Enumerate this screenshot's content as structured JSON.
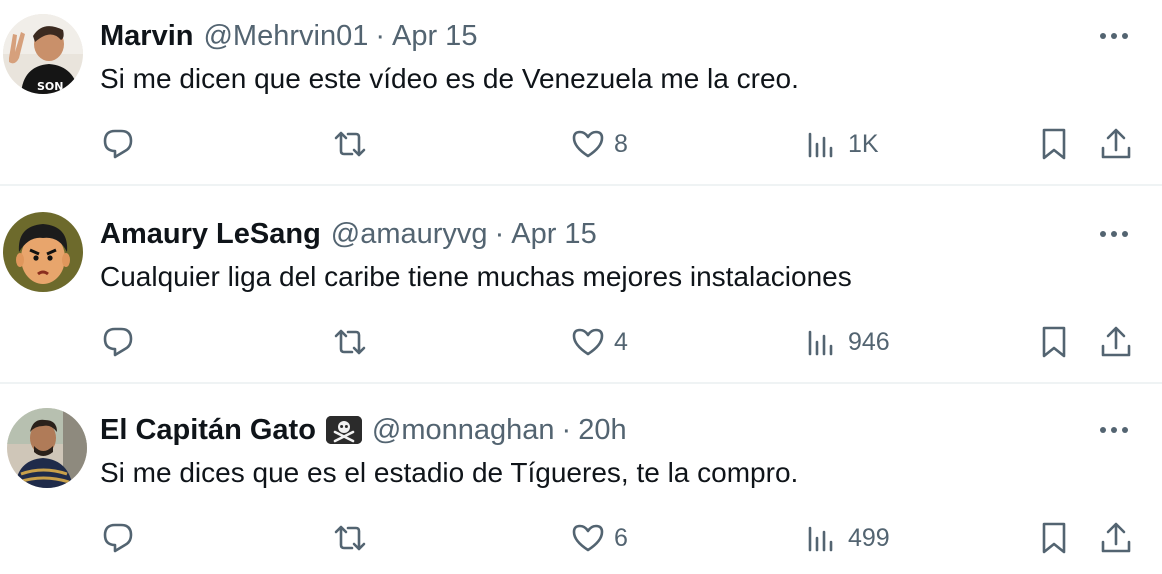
{
  "tweets": [
    {
      "display_name": "Marvin",
      "handle": "@Mehrvin01",
      "separator": "·",
      "time": "Apr 15",
      "text": "Si me dicen que este vídeo es de Venezuela me la creo.",
      "likes": "8",
      "views": "1K",
      "avatar_icon": "avatar-photo-peace-sign"
    },
    {
      "display_name": "Amaury LeSang",
      "handle": "@amauryvg",
      "separator": "·",
      "time": "Apr 15",
      "text": "Cualquier liga del caribe tiene muchas mejores instalaciones",
      "likes": "4",
      "views": "946",
      "avatar_icon": "avatar-cartoon-face"
    },
    {
      "display_name": "El Capitán Gato",
      "name_emoji": "pirate-flag-icon",
      "handle": "@monnaghan",
      "separator": "·",
      "time": "20h",
      "text": "Si me dices que es el estadio de Tígueres, te la compro.",
      "likes": "6",
      "views": "499",
      "avatar_icon": "avatar-photo-man"
    }
  ],
  "colors": {
    "text_primary": "#0f1419",
    "text_secondary": "#536471",
    "divider": "#eff3f4"
  },
  "icons": {
    "reply": "reply-icon",
    "retweet": "retweet-icon",
    "like": "heart-icon",
    "views": "views-icon",
    "bookmark": "bookmark-icon",
    "share": "share-icon",
    "more": "more-icon"
  }
}
